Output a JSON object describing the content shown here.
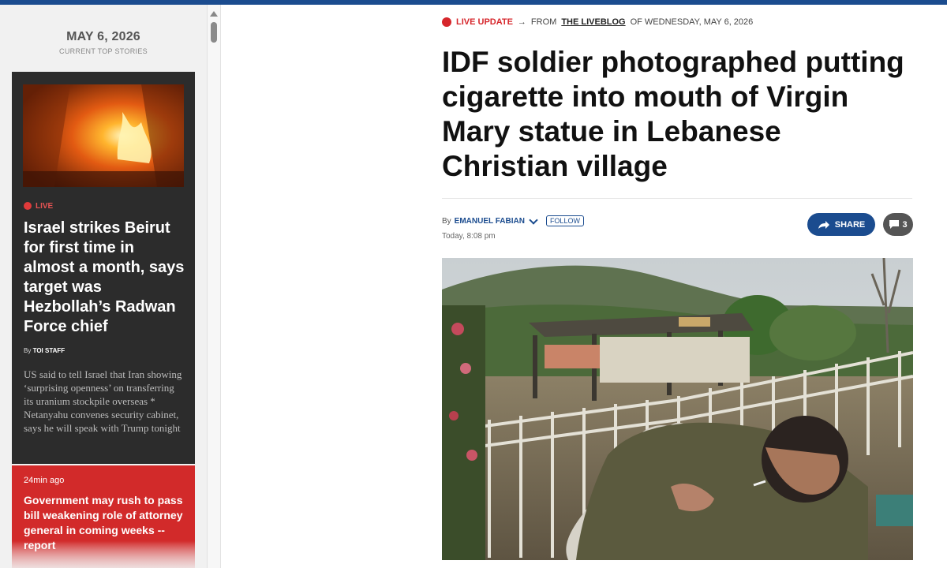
{
  "sidebar": {
    "date": "MAY 6, 2026",
    "subtitle": "CURRENT TOP STORIES",
    "featured": {
      "live_label": "LIVE",
      "title": "Israel strikes Beirut for first time in almost a month, says target was Hezbollah’s Radwan Force chief",
      "byline_prefix": "By",
      "byline_author": "TOI STAFF",
      "description": "US said to tell Israel that Iran showing ‘surprising openness’ on transferring its uranium stockpile overseas * Netanyahu convenes security cabinet, says he will speak with Trump tonight"
    },
    "next_story": {
      "time": "24min ago",
      "title": "Government may rush to pass bill weakening role of attorney general in coming weeks -- report"
    }
  },
  "article": {
    "kicker": {
      "live_label": "LIVE UPDATE",
      "arrow": "→",
      "from_text": "FROM",
      "blog_name": "THE LIVEBLOG",
      "date_text": "OF WEDNESDAY, MAY 6, 2026"
    },
    "headline": "IDF soldier photographed putting cigarette into mouth of Virgin Mary statue in Lebanese Christian village",
    "byline": {
      "prefix": "By",
      "author": "EMANUEL FABIAN",
      "follow_label": "FOLLOW",
      "date": "Today, 8:08 pm"
    },
    "share_label": "SHARE",
    "comment_count": "3"
  },
  "colors": {
    "brand_blue": "#1b4c8f",
    "live_red": "#d6262b",
    "dark_card": "#2c2c2c",
    "red_card": "#d22a2a"
  },
  "icons": {
    "share": "share-arrow-icon",
    "comment": "comment-bubble-icon",
    "live": "live-dot-icon",
    "scroll_up": "scroll-up-arrow-icon"
  }
}
